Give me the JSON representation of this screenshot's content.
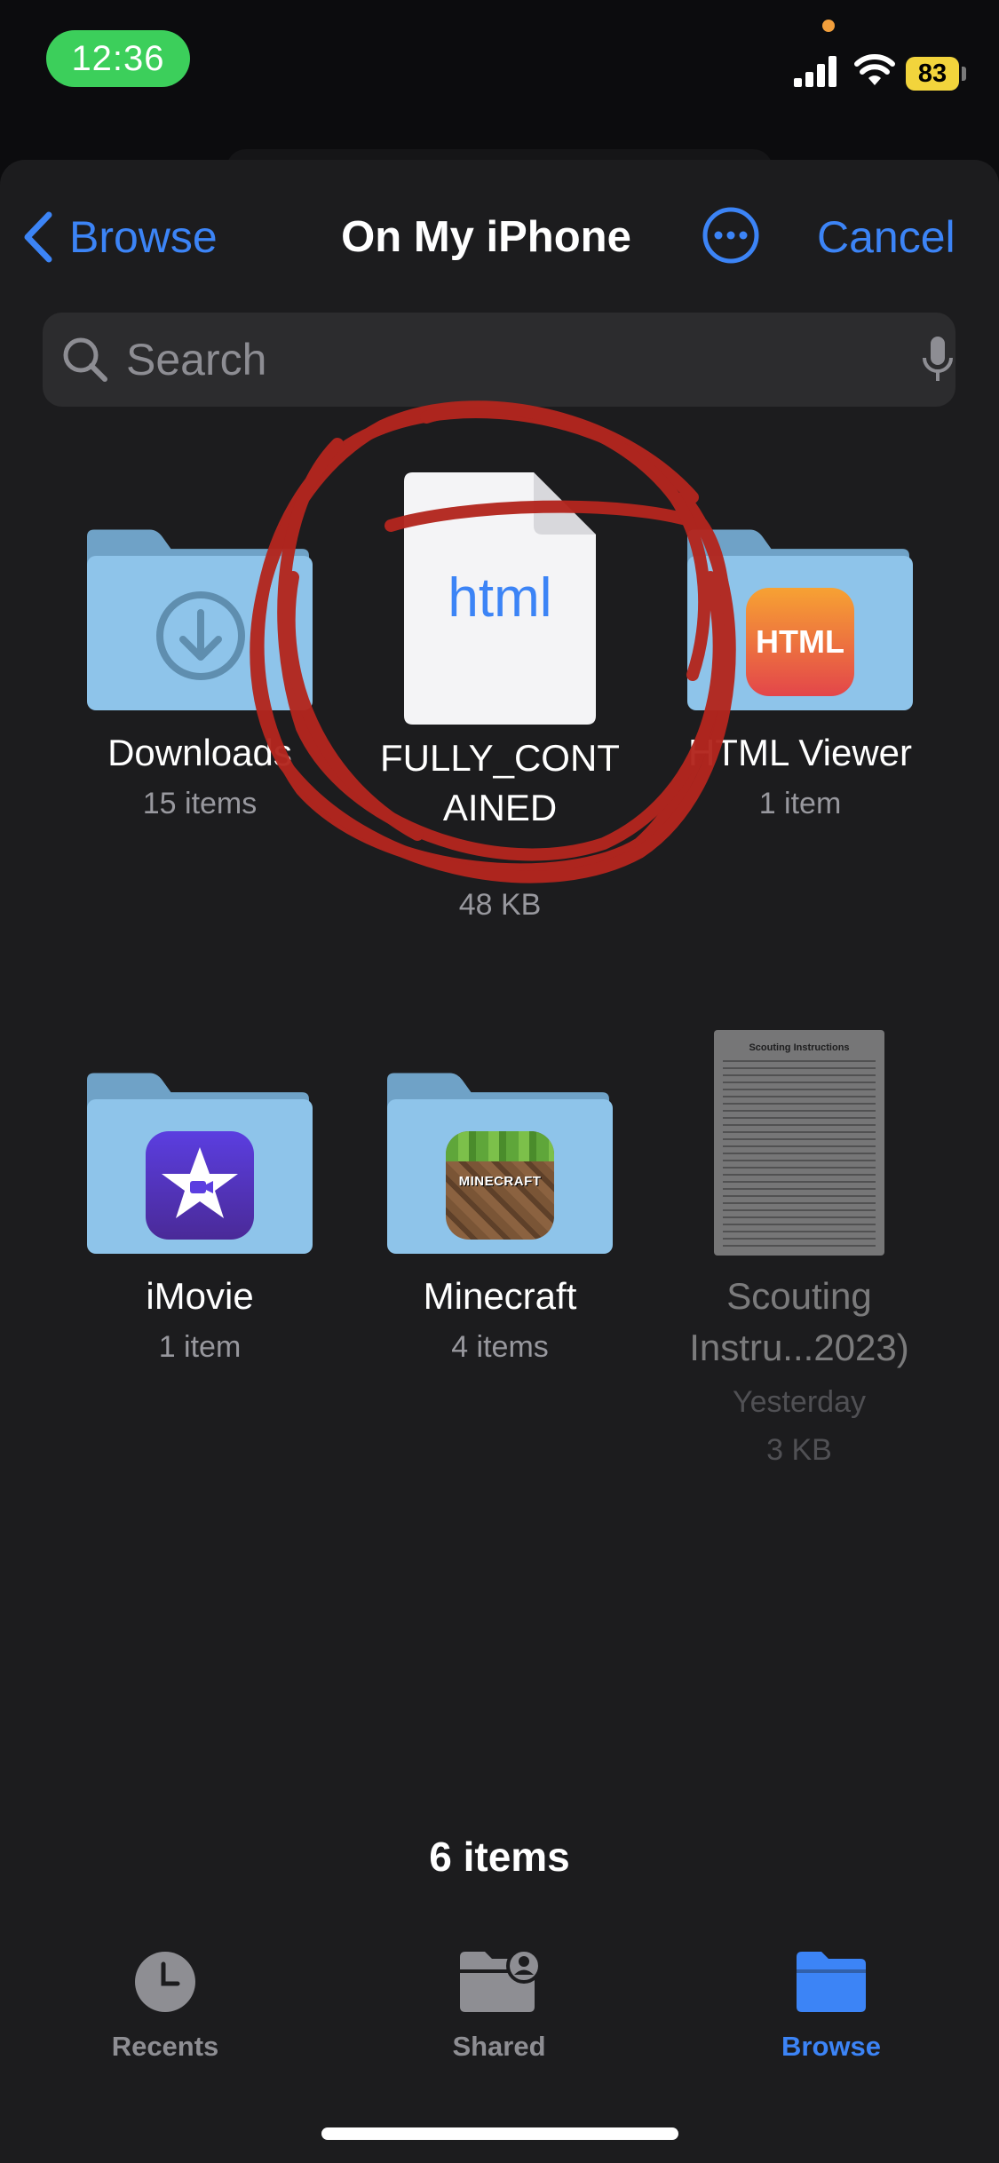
{
  "status_bar": {
    "time": "12:36",
    "battery": "83"
  },
  "nav": {
    "back_label": "Browse",
    "title": "On My iPhone",
    "cancel_label": "Cancel"
  },
  "search": {
    "placeholder": "Search"
  },
  "items": [
    {
      "name": "Downloads",
      "sub": "15 items",
      "kind": "folder",
      "icon": "download-icon"
    },
    {
      "name": "FULLY_CONTAINED",
      "name_line1": "FULLY_CONT",
      "name_line2": "AINED",
      "file_type": "html",
      "size": "48 KB",
      "kind": "file",
      "icon": "html-file-icon"
    },
    {
      "name": "HTML Viewer",
      "sub": "1 item",
      "kind": "folder",
      "icon_label": "HTML",
      "icon": "html-viewer-app-icon"
    },
    {
      "name": "iMovie",
      "sub": "1 item",
      "kind": "folder",
      "icon": "imovie-app-icon"
    },
    {
      "name": "Minecraft",
      "sub": "4 items",
      "kind": "folder",
      "icon_label": "MINECRAFT",
      "icon": "minecraft-app-icon"
    },
    {
      "name_line1": "Scouting",
      "name_line2": "Instru...2023)",
      "date": "Yesterday",
      "size": "3 KB",
      "kind": "document",
      "doc_title": "Scouting Instructions",
      "icon": "document-thumbnail"
    }
  ],
  "footer": {
    "count": "6 items"
  },
  "tabs": [
    {
      "label": "Recents",
      "icon": "clock-icon",
      "selected": false
    },
    {
      "label": "Shared",
      "icon": "shared-folder-icon",
      "selected": false
    },
    {
      "label": "Browse",
      "icon": "folder-icon",
      "selected": true
    }
  ],
  "colors": {
    "accent": "#3c84f6",
    "folder": "#8ec4ea",
    "annotation": "#b3261e",
    "time_pill": "#3ccf5b",
    "battery": "#f2d43c"
  }
}
